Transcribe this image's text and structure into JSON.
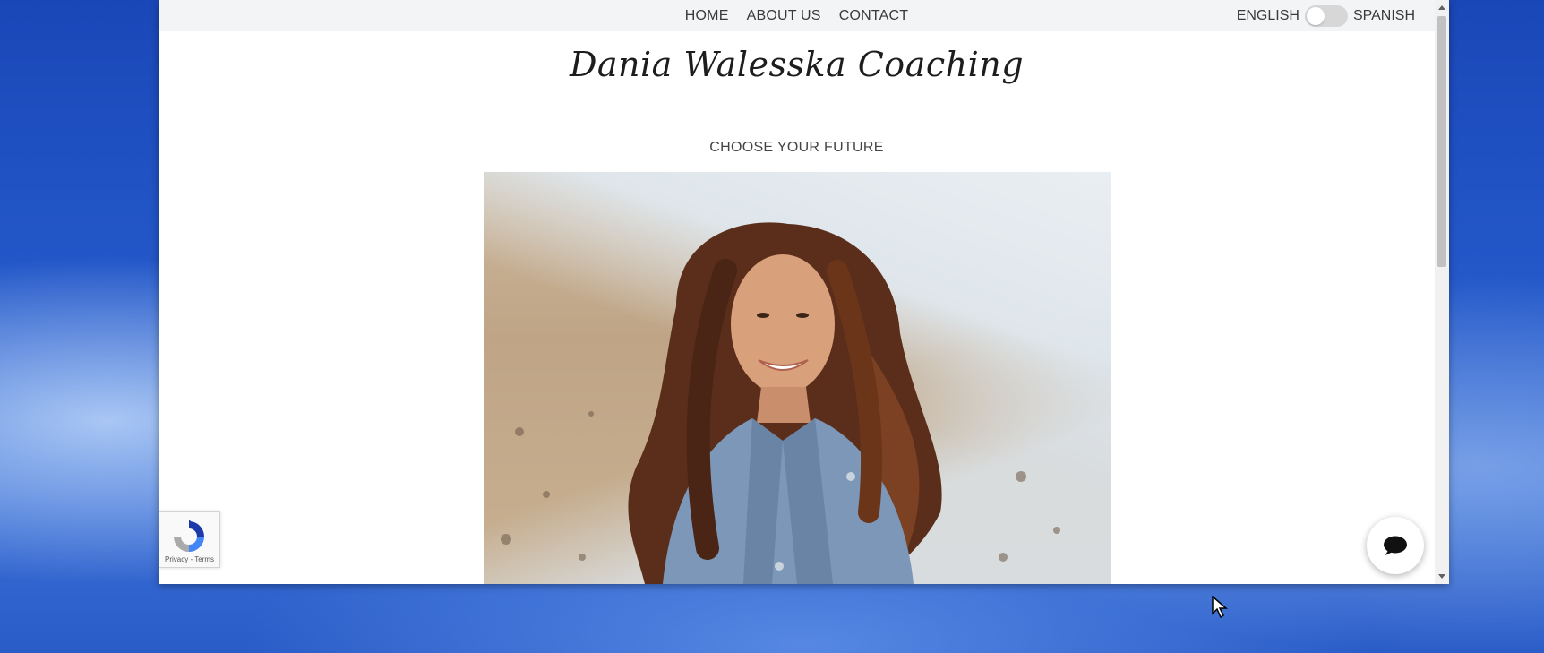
{
  "nav": {
    "links": [
      "HOME",
      "ABOUT US",
      "CONTACT"
    ]
  },
  "language": {
    "left_label": "ENGLISH",
    "right_label": "SPANISH",
    "toggle_state": "off"
  },
  "brand": {
    "title": "Dania Walesska Coaching"
  },
  "hero": {
    "tagline": "CHOOSE YOUR FUTURE"
  },
  "recaptcha": {
    "privacy_label": "Privacy",
    "separator": "-",
    "terms_label": "Terms"
  },
  "chat": {
    "icon": "chat-bubble-icon"
  },
  "colors": {
    "nav_bg": "#f3f4f6",
    "text": "#3a3a3a",
    "desktop_blue": "#2357c8"
  }
}
